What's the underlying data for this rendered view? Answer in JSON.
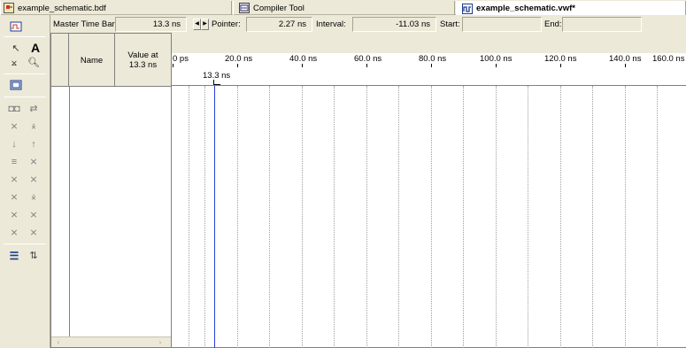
{
  "tabs": [
    {
      "label": "example_schematic.bdf",
      "icon": "block-diagram-icon",
      "active": false
    },
    {
      "label": "Compiler Tool",
      "icon": "compiler-icon",
      "active": false
    },
    {
      "label": "example_schematic.vwf*",
      "icon": "waveform-file-icon",
      "active": true
    }
  ],
  "master": {
    "master_time_label": "Master Time Bar:",
    "master_time_value": "13.3 ns",
    "pointer_label": "Pointer:",
    "pointer_value": "2.27 ns",
    "interval_label": "Interval:",
    "interval_value": "-11.03 ns",
    "start_label": "Start:",
    "start_value": "",
    "end_label": "End:",
    "end_value": ""
  },
  "names_panel": {
    "name_header": "Name",
    "value_header": "Value at\n13.3 ns"
  },
  "ruler": {
    "labels": [
      "0 ps",
      "20.0 ns",
      "40.0 ns",
      "60.0 ns",
      "80.0 ns",
      "100.0 ns",
      "120.0 ns",
      "140.0 ns",
      "160.0 ns"
    ],
    "marker_label": "13.3 ns"
  },
  "toolbar": {
    "icons": [
      "select-arrow-icon",
      "text-tool-icon",
      "waveform-edit-icon",
      "zoom-icon",
      "fullscreen-icon",
      "find-icon",
      "replace-icon",
      "invert-icon",
      "count-value-icon",
      "forcing-low-icon",
      "forcing-high-icon",
      "weak-low-icon",
      "weak-high-icon",
      "uninitialized-icon",
      "random-value-icon",
      "high-impedance-icon",
      "dont-care-icon",
      "forcing-unknown-icon",
      "arbitrary-value-icon",
      "clock-icon",
      "overwrite-value-icon",
      "sort-icon",
      "group-icon"
    ]
  },
  "colors": {
    "chrome": "#ece9d8",
    "marker": "#2a3fd6"
  }
}
